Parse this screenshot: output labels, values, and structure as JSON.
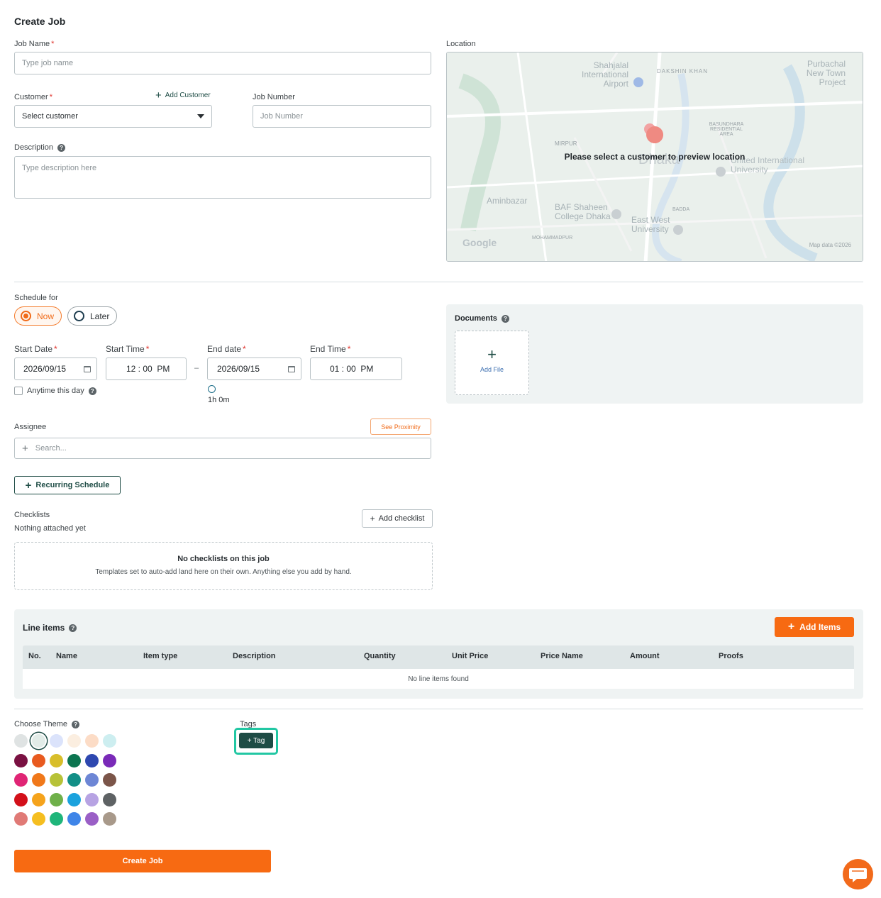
{
  "page": {
    "title": "Create Job"
  },
  "job_name": {
    "label": "Job Name",
    "placeholder": "Type job name"
  },
  "customer": {
    "label": "Customer",
    "add_label": "Add Customer",
    "placeholder": "Select customer"
  },
  "job_number": {
    "label": "Job Number",
    "placeholder": "Job Number"
  },
  "description": {
    "label": "Description",
    "placeholder": "Type description here"
  },
  "location": {
    "label": "Location",
    "message": "Please select a customer to preview location",
    "map_labels": [
      "Shahjalal International Airport",
      "DAKSHIN KHAN",
      "Purbachal New Town Project",
      "BASUNDHARA RESIDENTIAL AREA",
      "MIRPUR",
      "Dhaka",
      "United International University",
      "Aminbazar",
      "BAF Shaheen College Dhaka",
      "East West University",
      "BADDA",
      "MOHAMMADPUR"
    ],
    "google": "Google",
    "map_data": "Map data ©2026"
  },
  "schedule": {
    "label": "Schedule for",
    "options": [
      "Now",
      "Later"
    ],
    "selected": "Now"
  },
  "start_date": {
    "label": "Start Date",
    "value": "2026/09/15"
  },
  "start_time": {
    "label": "Start Time",
    "value": "12 : 00  PM"
  },
  "end_date": {
    "label": "End date",
    "value": "2026/09/15"
  },
  "end_time": {
    "label": "End Time",
    "value": "01 : 00  PM"
  },
  "range_separator": "–",
  "duration": "1h 0m",
  "anytime": {
    "label": "Anytime this day",
    "checked": false
  },
  "assignee": {
    "label": "Assignee",
    "proximity_label": "See Proximity",
    "placeholder": "Search..."
  },
  "recurring": {
    "label": "Recurring Schedule"
  },
  "checklists": {
    "label": "Checklists",
    "status": "Nothing attached yet",
    "add_label": "Add checklist",
    "empty_title": "No checklists on this job",
    "empty_text": "Templates set to auto-add land here on their own. Anything else you add by hand."
  },
  "documents": {
    "label": "Documents",
    "add_file": "Add File"
  },
  "line_items": {
    "label": "Line items",
    "add_label": "Add Items",
    "columns": [
      "No.",
      "Name",
      "Item type",
      "Description",
      "Quantity",
      "Unit Price",
      "Price Name",
      "Amount",
      "Proofs"
    ],
    "empty": "No line items found"
  },
  "theme": {
    "label": "Choose Theme",
    "selected_index": 1,
    "colors": [
      [
        "#dfe3e3",
        "#e2ece8",
        "#dbe3fb",
        "#fbeee0",
        "#fcdcc6",
        "#cdeef0"
      ],
      [
        "#7a1142",
        "#e85a1f",
        "#d8be2a",
        "#0c7550",
        "#2e48b0",
        "#7a2ab8"
      ],
      [
        "#e02575",
        "#f0781a",
        "#b7c238",
        "#138f87",
        "#6d86d5",
        "#7b5549"
      ],
      [
        "#d3101a",
        "#f5a31c",
        "#6fb04a",
        "#1ba2dd",
        "#b7a3e3",
        "#5e6264"
      ],
      [
        "#e07a76",
        "#f5be20",
        "#1fb57a",
        "#3f85e8",
        "#9a5fc6",
        "#a8998a"
      ]
    ]
  },
  "tags": {
    "label": "Tags",
    "add_label": "+ Tag"
  },
  "submit": {
    "label": "Create Job"
  },
  "colors": {
    "accent": "#f76a12",
    "primary_dark": "#1e4c45",
    "focus": "#22c7a3"
  }
}
